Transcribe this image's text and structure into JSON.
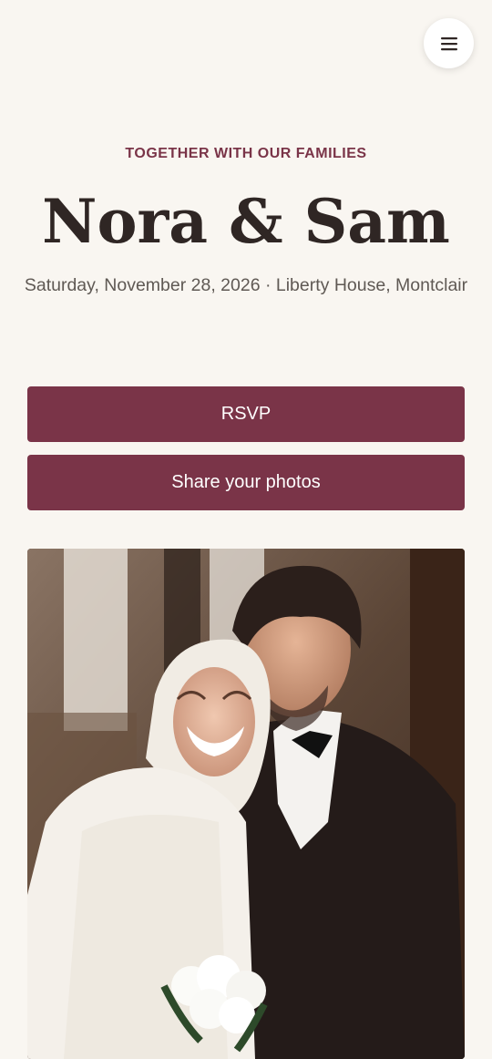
{
  "header": {
    "menu_icon": "hamburger-menu-icon"
  },
  "hero": {
    "eyebrow": "TOGETHER WITH OUR FAMILIES",
    "title": "Nora & Sam",
    "details": "Saturday, November 28, 2026 · Liberty House, Montclair"
  },
  "actions": {
    "rsvp_label": "RSVP",
    "share_label": "Share your photos"
  },
  "colors": {
    "background": "#f9f6f1",
    "accent": "#7a3448",
    "title": "#2f2624",
    "details": "#5f5954"
  }
}
